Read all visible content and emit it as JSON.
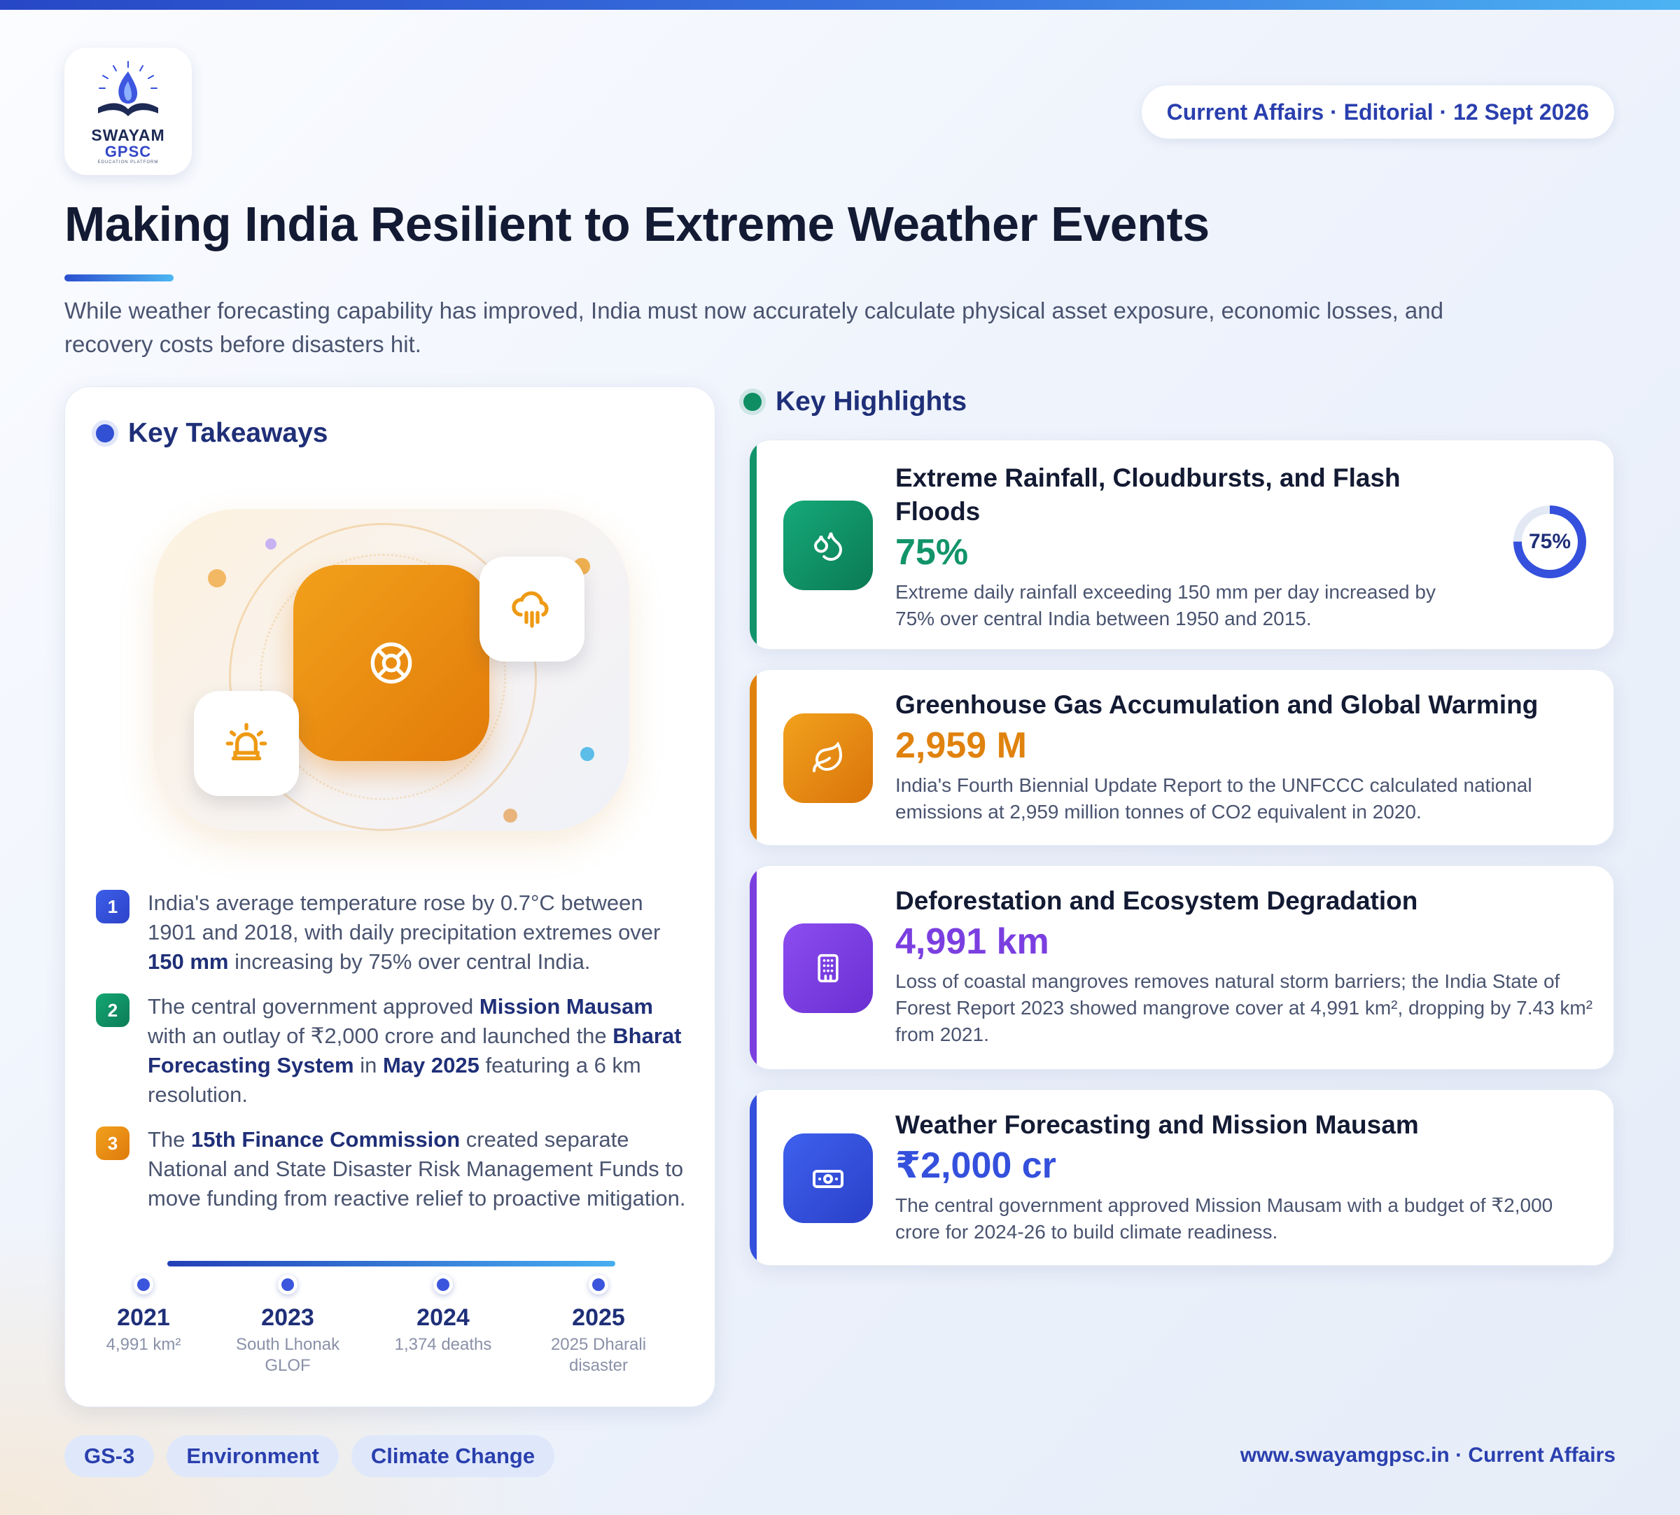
{
  "brand": {
    "line1": "SWAYAM",
    "line2": "GPSC",
    "tagline": "EDUCATION PLATFORM"
  },
  "header": {
    "meta_pill": "Current Affairs · Editorial · 12 Sept 2026",
    "title": "Making India Resilient to Extreme Weather Events",
    "subtitle": "While weather forecasting capability has improved, India must now accurately calculate physical asset exposure, economic losses, and recovery costs before disasters hit."
  },
  "takeaways": {
    "heading": "Key Takeaways",
    "items": [
      {
        "num": "1",
        "parts": [
          {
            "t": "India's average temperature rose by 0.7°C between 1901 and 2018, with daily precipitation extremes over "
          },
          {
            "t": "150 mm",
            "bold": true
          },
          {
            "t": " increasing by 75% over central India."
          }
        ]
      },
      {
        "num": "2",
        "parts": [
          {
            "t": "The central government approved "
          },
          {
            "t": "Mission Mausam",
            "bold": true
          },
          {
            "t": " with an outlay of ₹2,000 crore and launched the "
          },
          {
            "t": "Bharat Forecasting System",
            "bold": true
          },
          {
            "t": " in "
          },
          {
            "t": "May 2025",
            "bold": true
          },
          {
            "t": " featuring a 6 km resolution."
          }
        ]
      },
      {
        "num": "3",
        "parts": [
          {
            "t": "The "
          },
          {
            "t": "15th Finance Commission",
            "bold": true
          },
          {
            "t": " created separate National and State Disaster Risk Management Funds to move funding from reactive relief to proactive mitigation."
          }
        ]
      }
    ],
    "timeline": [
      {
        "year": "2021",
        "desc": "4,991 km²"
      },
      {
        "year": "2023",
        "desc": "South Lhonak GLOF"
      },
      {
        "year": "2024",
        "desc": "1,374 deaths"
      },
      {
        "year": "2025",
        "desc": "2025 Dharali disaster"
      }
    ]
  },
  "highlights": {
    "heading": "Key Highlights",
    "cards": [
      {
        "title": "Extreme Rainfall, Cloudbursts, and Flash Floods",
        "stat": "75%",
        "desc": "Extreme daily rainfall exceeding 150 mm per day increased by 75% over central India between 1950 and 2015.",
        "color": "#12946a",
        "icon": "droplets-icon",
        "gauge_label": "75%",
        "gauge_value": 0.75
      },
      {
        "title": "Greenhouse Gas Accumulation and Global Warming",
        "stat": "2,959 M",
        "desc": "India's Fourth Biennial Update Report to the UNFCCC calculated national emissions at 2,959 million tonnes of CO2 equivalent in 2020.",
        "color": "#e0820e",
        "icon": "leaf-icon"
      },
      {
        "title": "Deforestation and Ecosystem Degradation",
        "stat": "4,991 km",
        "desc": "Loss of coastal mangroves removes natural storm barriers; the India State of Forest Report 2023 showed mangrove cover at 4,991 km², dropping by 7.43 km² from 2021.",
        "color": "#7b3fe0",
        "icon": "building-icon"
      },
      {
        "title": "Weather Forecasting and Mission Mausam",
        "stat": "₹2,000 cr",
        "desc": "The central government approved Mission Mausam with a budget of ₹2,000 crore for 2024-26 to build climate readiness.",
        "color": "#3450dc",
        "icon": "banknote-icon"
      }
    ]
  },
  "footer": {
    "tags": [
      "GS-3",
      "Environment",
      "Climate Change"
    ],
    "url": "www.swayamgpsc.in · Current Affairs"
  }
}
